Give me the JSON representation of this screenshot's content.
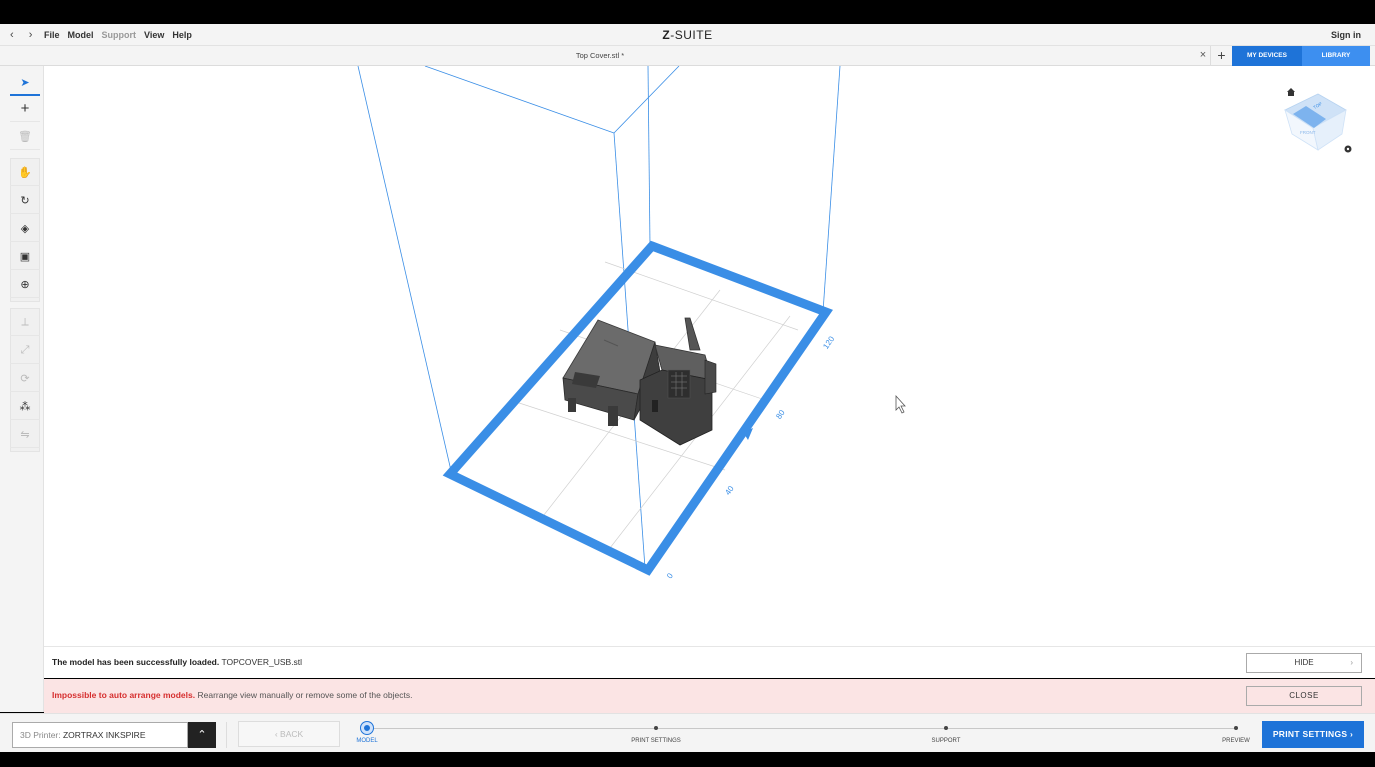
{
  "menubar": {
    "back_arrow": "‹",
    "forward_arrow": "›",
    "items": [
      "File",
      "Model",
      "Support",
      "View",
      "Help"
    ],
    "app_title_bold": "Z",
    "app_title_rest": "-SUITE",
    "signin": "Sign in"
  },
  "tabbar": {
    "doc_title": "Top Cover.stl *",
    "close_glyph": "×",
    "add_glyph": "+",
    "my_devices": "MY DEVICES",
    "library": "LIBRARY"
  },
  "toolbar": {
    "tools": [
      {
        "name": "select-tool",
        "icon": "pointer-icon",
        "glyph": "➤",
        "state": "active"
      },
      {
        "name": "add-model-tool",
        "icon": "plus-icon",
        "glyph": "+",
        "state": "normal"
      },
      {
        "name": "delete-tool",
        "icon": "trash-icon",
        "glyph": "🗑",
        "state": "disabled"
      },
      {
        "name": "pan-tool",
        "icon": "hand-icon",
        "glyph": "✋",
        "state": "normal"
      },
      {
        "name": "rotate-view-tool",
        "icon": "rotate-icon",
        "glyph": "↻",
        "state": "normal"
      },
      {
        "name": "view-cube-tool",
        "icon": "cube-icon",
        "glyph": "◈",
        "state": "normal"
      },
      {
        "name": "camera-tool",
        "icon": "camera-icon",
        "glyph": "▣",
        "state": "normal"
      },
      {
        "name": "zoom-tool",
        "icon": "zoom-in-icon",
        "glyph": "⊕",
        "state": "normal"
      },
      {
        "name": "move-tool",
        "icon": "move-axes-icon",
        "glyph": "⟂",
        "state": "disabled"
      },
      {
        "name": "scale-tool",
        "icon": "scale-icon",
        "glyph": "⤢",
        "state": "disabled"
      },
      {
        "name": "rotate-model-tool",
        "icon": "rotate-model-icon",
        "glyph": "⟳",
        "state": "disabled"
      },
      {
        "name": "auto-arrange-tool",
        "icon": "arrange-icon",
        "glyph": "⁂",
        "state": "normal"
      },
      {
        "name": "mirror-tool",
        "icon": "mirror-icon",
        "glyph": "⇋",
        "state": "disabled"
      }
    ]
  },
  "viewport": {
    "axis_labels": [
      "0",
      "40",
      "80",
      "120"
    ],
    "viewcube_labels": [
      "TOP",
      "FRONT"
    ],
    "accent": "#3a8ee6"
  },
  "messages": {
    "loaded_bold": "The model has been successfully loaded.",
    "loaded_rest": " TOPCOVER_USB.stl",
    "hide_label": "HIDE",
    "error_bold": "Impossible to auto arrange models.",
    "error_rest": " Rearrange view manually or remove some of the objects.",
    "close_label": "CLOSE"
  },
  "bottombar": {
    "printer_label": "3D Printer:",
    "printer_value": " ZORTRAX INKSPIRE",
    "caret": "⌃",
    "back_label": "‹  BACK",
    "steps": [
      "MODEL",
      "PRINT SETTINGS",
      "SUPPORT",
      "PREVIEW"
    ],
    "print_settings_button": "PRINT SETTINGS  ›"
  },
  "colors": {
    "primary": "#1e73d8",
    "bed_outline": "#3a8ee6",
    "error_bg": "#fbe4e4",
    "error_text": "#d62f2f"
  }
}
